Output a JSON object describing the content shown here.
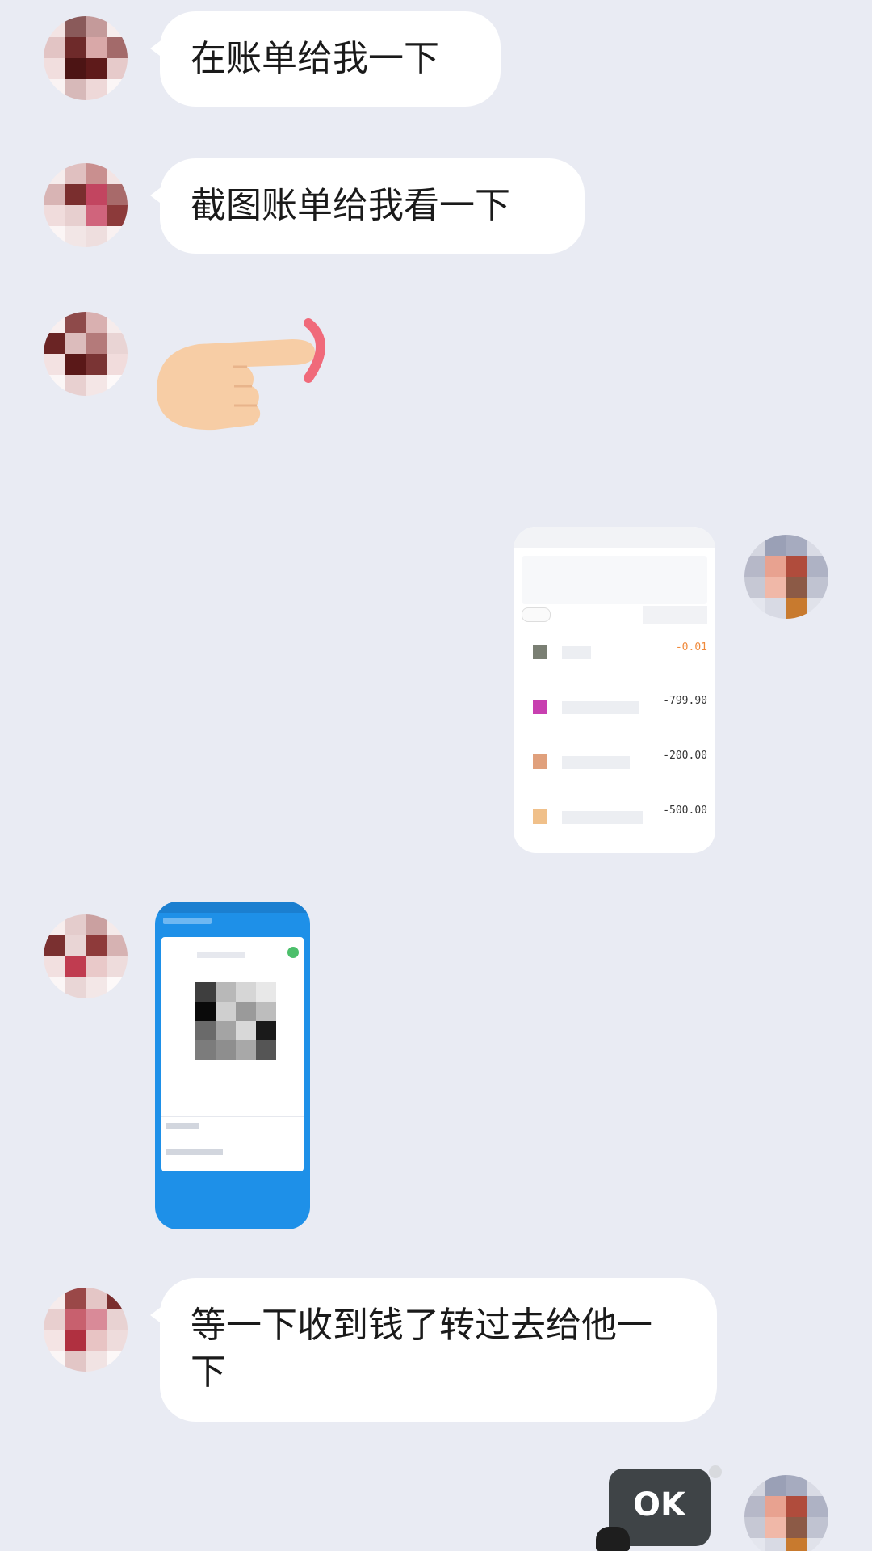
{
  "messages": [
    {
      "id": "m1",
      "sender": "other",
      "type": "text",
      "text": "在账单给我一下"
    },
    {
      "id": "m2",
      "sender": "other",
      "type": "text",
      "text": "截图账单给我看一下"
    },
    {
      "id": "m3",
      "sender": "other",
      "type": "sticker",
      "sticker": "pointing-finger-emoji"
    },
    {
      "id": "m4",
      "sender": "self",
      "type": "image",
      "image": "bill-screenshot",
      "bill_amounts": [
        "-0.01",
        "-799.90",
        "-200.00",
        "-500.00"
      ]
    },
    {
      "id": "m5",
      "sender": "other",
      "type": "image",
      "image": "phone-qr-screenshot"
    },
    {
      "id": "m6",
      "sender": "other",
      "type": "text",
      "text": "等一下收到钱了转过去给他一下"
    },
    {
      "id": "m7",
      "sender": "self",
      "type": "sticker",
      "sticker": "ok-sticker",
      "sticker_text": "OK"
    }
  ],
  "colors": {
    "background": "#e9ebf3",
    "bubble": "#ffffff",
    "negative_amount_accent": "#f08a3c",
    "phone_blue": "#1e90e8"
  }
}
